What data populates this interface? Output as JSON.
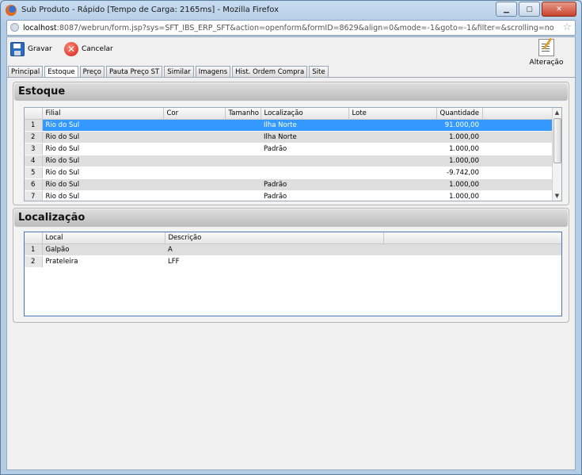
{
  "window": {
    "title": "Sub Produto - Rápido [Tempo de Carga: 2165ms] - Mozilla Firefox",
    "url_host": "localhost",
    "url_rest": ":8087/webrun/form.jsp?sys=SFT_IBS_ERP_SFT&action=openform&formID=8629&align=0&mode=-1&goto=-1&filter=&scrolling=no"
  },
  "toolbar": {
    "save_label": "Gravar",
    "cancel_label": "Cancelar",
    "alteracao_label": "Alteração"
  },
  "tabs": [
    {
      "label": "Principal"
    },
    {
      "label": "Estoque",
      "active": true
    },
    {
      "label": "Preço"
    },
    {
      "label": "Pauta Preço ST"
    },
    {
      "label": "Similar"
    },
    {
      "label": "Imagens"
    },
    {
      "label": "Hist. Ordem Compra"
    },
    {
      "label": "Site"
    }
  ],
  "estoque": {
    "title": "Estoque",
    "columns": [
      "Filial",
      "Cor",
      "Tamanho",
      "Localização",
      "Lote",
      "Quantidade"
    ],
    "rows": [
      {
        "n": "1",
        "filial": "Rio do Sul",
        "cor": "",
        "tamanho": "",
        "localizacao": "Ilha Norte",
        "lote": "",
        "quantidade": "91.000,00",
        "selected": true
      },
      {
        "n": "2",
        "filial": "Rio do Sul",
        "cor": "",
        "tamanho": "",
        "localizacao": "Ilha Norte",
        "lote": "",
        "quantidade": "1.000,00"
      },
      {
        "n": "3",
        "filial": "Rio do Sul",
        "cor": "",
        "tamanho": "",
        "localizacao": "Padrão",
        "lote": "",
        "quantidade": "1.000,00"
      },
      {
        "n": "4",
        "filial": "Rio do Sul",
        "cor": "",
        "tamanho": "",
        "localizacao": "",
        "lote": "",
        "quantidade": "1.000,00"
      },
      {
        "n": "5",
        "filial": "Rio do Sul",
        "cor": "",
        "tamanho": "",
        "localizacao": "",
        "lote": "",
        "quantidade": "-9.742,00"
      },
      {
        "n": "6",
        "filial": "Rio do Sul",
        "cor": "",
        "tamanho": "",
        "localizacao": "Padrão",
        "lote": "",
        "quantidade": "1.000,00"
      },
      {
        "n": "7",
        "filial": "Rio do Sul",
        "cor": "",
        "tamanho": "",
        "localizacao": "Padrão",
        "lote": "",
        "quantidade": "1.000,00"
      }
    ]
  },
  "localizacao": {
    "title": "Localização",
    "columns": [
      "Local",
      "Descrição"
    ],
    "rows": [
      {
        "n": "1",
        "local": "Galpão",
        "descricao": "A"
      },
      {
        "n": "2",
        "local": "Prateleira",
        "descricao": "LFF"
      }
    ]
  },
  "colors": {
    "selection": "#3399ff",
    "alt_row": "#dedede"
  }
}
